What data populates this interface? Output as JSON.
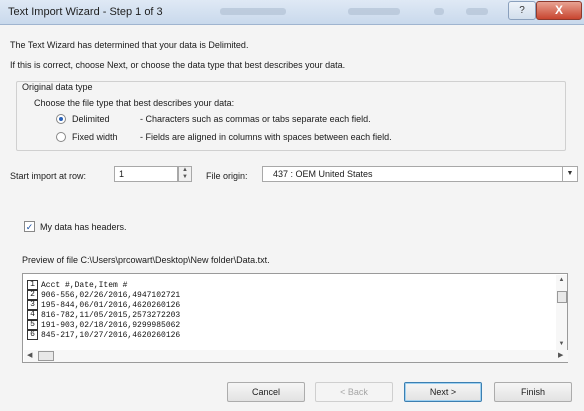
{
  "window": {
    "title": "Text Import Wizard - Step 1 of 3",
    "help_label": "?",
    "close_label": "X"
  },
  "intro": {
    "line1": "The Text Wizard has determined that your data is Delimited.",
    "line2": "If this is correct, choose Next, or choose the data type that best describes your data."
  },
  "data_type": {
    "group_label": "Original data type",
    "prompt": "Choose the file type that best describes your data:",
    "options": [
      {
        "label": "Delimited",
        "description": "- Characters such as commas or tabs separate each field.",
        "selected": true
      },
      {
        "label": "Fixed width",
        "description": "- Fields are aligned in columns with spaces between each field.",
        "selected": false
      }
    ]
  },
  "start_import": {
    "label": "Start import at row:",
    "value": "1"
  },
  "file_origin": {
    "label": "File origin:",
    "value": "437 : OEM United States"
  },
  "headers": {
    "label": "My data has headers.",
    "checked": true
  },
  "preview": {
    "label": "Preview of file C:\\Users\\prcowart\\Desktop\\New folder\\Data.txt.",
    "rows": [
      {
        "num": "1",
        "text": "Acct #,Date,Item #"
      },
      {
        "num": "2",
        "text": "906-556,02/26/2016,4947102721"
      },
      {
        "num": "3",
        "text": "195-844,06/01/2016,4620260126"
      },
      {
        "num": "4",
        "text": "816-782,11/05/2015,2573272203"
      },
      {
        "num": "5",
        "text": "191-903,02/18/2016,9299985062"
      },
      {
        "num": "6",
        "text": "845-217,10/27/2016,4620260126"
      }
    ]
  },
  "buttons": {
    "cancel": "Cancel",
    "back": "< Back",
    "next": "Next >",
    "finish": "Finish"
  },
  "icons": {
    "radio_selected": "radio-selected-icon",
    "checkbox_checked": "checkmark-icon",
    "dropdown": "chevron-down-icon"
  },
  "colors": {
    "title_bar": "#c9d9ec",
    "close_button": "#c8452f",
    "dialog_background": "#f4f4f4"
  }
}
